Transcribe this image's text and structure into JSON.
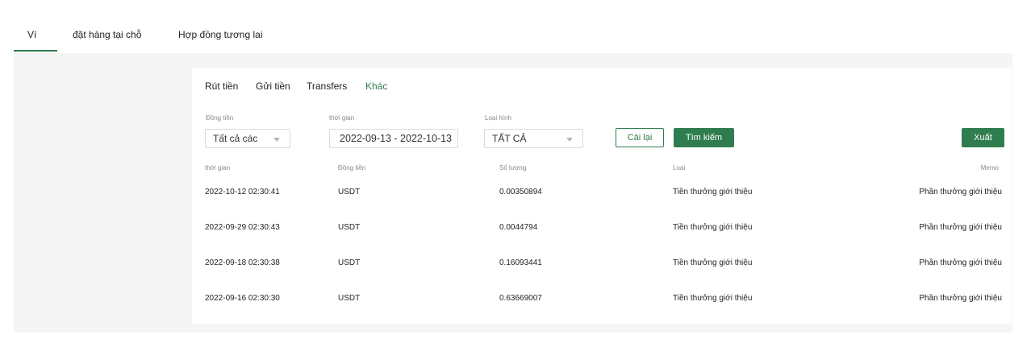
{
  "top_tabs": [
    {
      "label": "Ví",
      "active": true
    },
    {
      "label": "đặt hàng tại chỗ",
      "active": false
    },
    {
      "label": "Hợp đồng tương lai",
      "active": false
    }
  ],
  "sub_tabs": [
    {
      "label": "Rút tiền",
      "active": false
    },
    {
      "label": "Gửi tiền",
      "active": false
    },
    {
      "label": "Transfers",
      "active": false
    },
    {
      "label": "Khác",
      "active": true
    }
  ],
  "filters": {
    "currency": {
      "label": "Đồng tiền",
      "value": "Tất cả các"
    },
    "time": {
      "label": "thời gian",
      "value": "2022-09-13 - 2022-10-13"
    },
    "type": {
      "label": "Loại hình",
      "value": "TẤT CẢ"
    }
  },
  "buttons": {
    "reset": "Cài lại",
    "search": "Tìm kiếm",
    "export": "Xuất"
  },
  "table": {
    "headers": [
      "thời gian",
      "Đồng tiền",
      "Số lượng",
      "Loại",
      "Memo"
    ],
    "rows": [
      [
        "2022-10-12 02:30:41",
        "USDT",
        "0.00350894",
        "Tiền thưởng giới thiệu",
        "Phần thưởng giới thiệu"
      ],
      [
        "2022-09-29 02:30:43",
        "USDT",
        "0.0044794",
        "Tiền thưởng giới thiệu",
        "Phần thưởng giới thiệu"
      ],
      [
        "2022-09-18 02:30:38",
        "USDT",
        "0.16093441",
        "Tiền thưởng giới thiệu",
        "Phần thưởng giới thiệu"
      ],
      [
        "2022-09-16 02:30:30",
        "USDT",
        "0.63669007",
        "Tiền thưởng giới thiệu",
        "Phần thưởng giới thiệu"
      ]
    ]
  },
  "colors": {
    "accent": "#2f7d4e",
    "content_bg": "#f5f5f6"
  }
}
